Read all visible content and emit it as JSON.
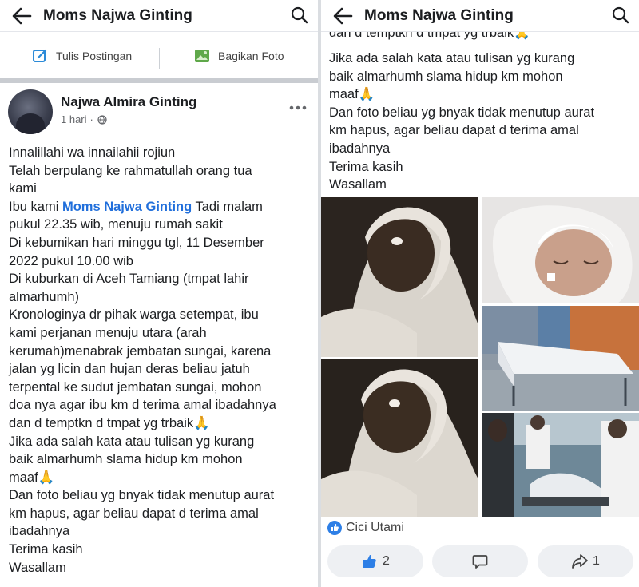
{
  "page": {
    "title": "Moms Najwa Ginting"
  },
  "left": {
    "actions": {
      "write_post": "Tulis Postingan",
      "share_photo": "Bagikan Foto"
    },
    "post": {
      "author": "Najwa Almira Ginting",
      "time": "1 hari",
      "meta_sep": "·",
      "lines": [
        "Innalillahi wa innailahii rojiun",
        "Telah berpulang ke rahmatullah orang tua",
        "kami",
        "",
        "pukul 22.35 wib, menuju rumah sakit",
        "Di kebumikan hari minggu tgl, 11 Desember",
        "2022 pukul 10.00 wib",
        "Di kuburkan di Aceh Tamiang (tmpat lahir",
        "almarhumh)",
        "Kronologinya dr pihak warga setempat, ibu",
        "kami perjanan menuju utara (arah",
        "kerumah)menabrak jembatan sungai, karena",
        "jalan yg licin dan hujan deras beliau jatuh",
        "terpental ke sudut jembatan sungai, mohon",
        "doa nya agar ibu km d terima amal ibadahnya",
        "dan d temptkn d tmpat yg trbaik🙏",
        "Jika ada salah kata atau tulisan yg kurang",
        "baik almarhumh slama hidup km mohon",
        "maaf🙏",
        "Dan foto beliau yg bnyak tidak menutup aurat",
        "km hapus, agar beliau dapat d terima amal",
        "ibadahnya",
        "Terima kasih",
        "Wasallam"
      ],
      "mention_line": {
        "before": "Ibu kami ",
        "mention": "Moms Najwa Ginting",
        "after": " Tadi malam"
      }
    }
  },
  "right": {
    "cut_line": "dan d temptkn d tmpat yg trbaik🙏",
    "lines": [
      "Jika ada salah kata atau tulisan yg kurang",
      "baik almarhumh slama hidup km mohon",
      "maaf🙏",
      "Dan foto beliau yg bnyak tidak menutup aurat",
      "km hapus, agar beliau dapat d terima amal",
      "ibadahnya",
      "Terima kasih",
      "Wasallam"
    ],
    "reactor": "Cici Utami",
    "like_count": "2",
    "share_count": "1"
  },
  "colors": {
    "accent": "#216fdb",
    "separator": "#c9ccd1",
    "button_bg": "#eef0f3"
  },
  "icons": [
    "back-arrow-icon",
    "search-icon",
    "edit-icon",
    "photo-icon",
    "globe-icon",
    "more-icon",
    "like-icon",
    "comment-icon",
    "share-icon"
  ]
}
